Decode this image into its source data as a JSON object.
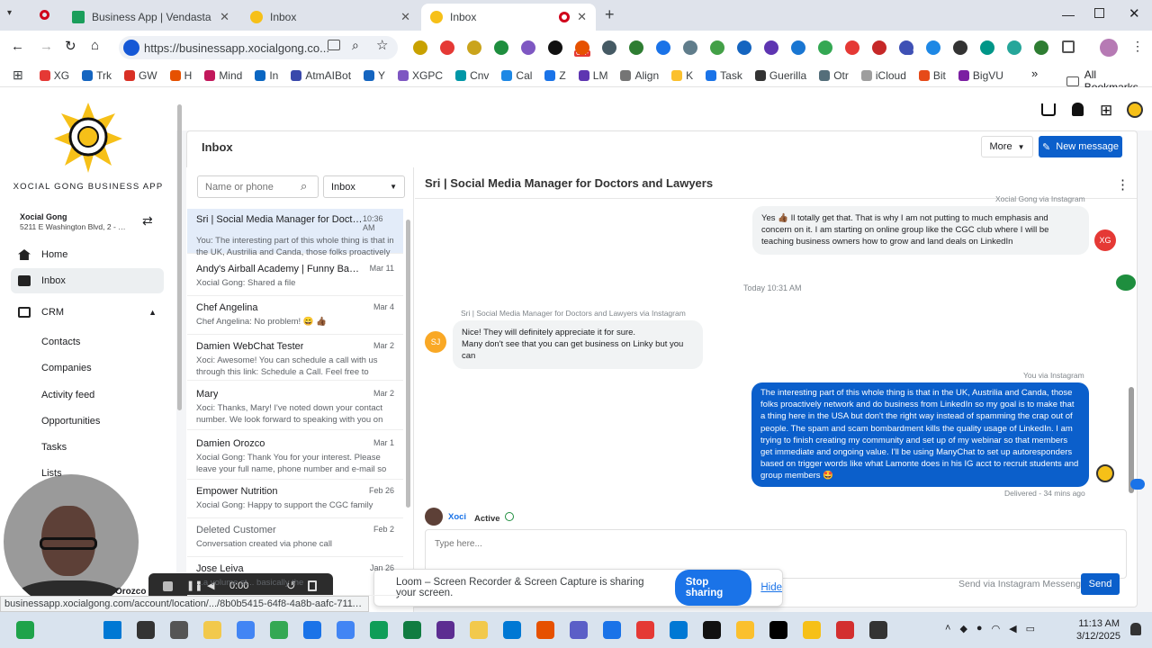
{
  "browser": {
    "tabs": [
      {
        "label": "Business App | Vendasta"
      },
      {
        "label": "Inbox"
      },
      {
        "label": "Inbox"
      }
    ],
    "new_tab": "+",
    "url": "https://businessapp.xocialgong.co...",
    "bookmarks": [
      "XG",
      "Trk",
      "GW",
      "H",
      "Mind",
      "In",
      "AtmAIBot",
      "Y",
      "XGPC",
      "Cnv",
      "Cal",
      "Z",
      "LM",
      "Align",
      "K",
      "Task",
      "Guerilla",
      "Otr",
      "iCloud",
      "Bit",
      "BigVU"
    ],
    "all_bookmarks": "All Bookmarks",
    "ext_badge": "28",
    "ext_off": "OFF"
  },
  "sidebar": {
    "brand": "XOCIAL GONG BUSINESS APP",
    "account_name": "Xocial Gong",
    "account_address": "5211 E Washington Blvd, 2 - 1...",
    "nav": [
      {
        "label": "Home"
      },
      {
        "label": "Inbox"
      },
      {
        "label": "CRM"
      }
    ],
    "crm_items": [
      "Contacts",
      "Companies",
      "Activity feed",
      "Opportunities",
      "Tasks",
      "Lists"
    ],
    "webcam_name": "Orozco"
  },
  "inbox": {
    "title": "Inbox",
    "more": "More",
    "new_message": "New message",
    "search_placeholder": "Name or phone",
    "filter": "Inbox",
    "conversations": [
      {
        "name": "Sri | Social Media Manager for Doctors and Lawyers",
        "date": "10:36 AM",
        "preview": "You: The interesting part of this whole thing is that in the UK, Austrilia and Canda, those folks proactively ..."
      },
      {
        "name": "Andy's Airball Academy | Funny Basketball",
        "date": "Mar 11",
        "preview": "Xocial Gong: Shared a file"
      },
      {
        "name": "Chef Angelina",
        "date": "Mar 4",
        "preview": "Chef Angelina: No problem! 😄 👍🏾"
      },
      {
        "name": "Damien WebChat Tester",
        "date": "Mar 2",
        "preview": "Xoci: Awesome! You can schedule a call with us through this link: Schedule a Call. Feel free to choose a ti..."
      },
      {
        "name": "Mary",
        "date": "Mar 2",
        "preview": "Xoci: Thanks, Mary! I've noted down your contact number. We look forward to speaking with you on the..."
      },
      {
        "name": "Damien Orozco",
        "date": "Mar 1",
        "preview": "Xocial Gong: Thank You for your interest. Please leave your full name, phone number and e-mail so that..."
      },
      {
        "name": "Empower Nutrition",
        "date": "Feb 26",
        "preview": "Xocial Gong: Happy to support the CGC family"
      },
      {
        "name": "Deleted Customer",
        "date": "Feb 2",
        "preview": "Conversation created via phone call"
      },
      {
        "name": "Jose Leiva",
        "date": "Jan 26",
        "preview": "...a volume st... basically the"
      }
    ]
  },
  "chat": {
    "title": "Sri | Social Media Manager for Doctors and Lawyers",
    "top_meta": "Xocial Gong via Instagram",
    "msg1": "Yes 👍🏾 Il totally get that. That is why I am not putting to much emphasis and concern on it. I am starting on online group like the CGC club where I will be teaching business owners how to grow and land deals on LinkedIn",
    "avatar_xg": "XG",
    "divider": "Today 10:31 AM",
    "in_meta_name": "Sri | Social Media Manager for Doctors and Lawyers",
    "in_meta_via": "via Instagram",
    "avatar_sj": "SJ",
    "msg2_line1": "Nice! They will definitely appreciate it for sure.",
    "msg2_line2": "Many don't see that you can get business on Linky but you can",
    "out_meta_you": "You",
    "out_meta_via": "via Instagram",
    "msg3": "The interesting part of this whole thing is that in the UK, Austrilia and Canda, those folks proactively network and do business from LinkedIn so my goal is to make that a thing here in the USA but don't the right way instead of spamming the crap out of people. The spam and scam bombardment kills the quality usage of LinkedIn. I am trying to finish creating my community and set up of my webinar so that members get immediate and ongoing value. I'll be using ManyChat to set up autoresponders based on trigger words like what Lamonte does in his IG acct to recruit students and group members 🤩",
    "delivered": "Delivered - 34 mins ago",
    "assignee": "Xoci",
    "active": "Active",
    "type_placeholder": "Type here...",
    "send_via": "Send via Instagram Messenger",
    "send": "Send"
  },
  "loom": {
    "text": "Loom – Screen Recorder & Screen Capture is sharing your screen.",
    "stop": "Stop sharing",
    "hide": "Hide",
    "timer": "0:00"
  },
  "statusbar": "businessapp.xocialgong.com/account/location/.../8b0b5415-64f8-4a8b-aafc-7111f023800a",
  "taskbar": {
    "time": "11:13 AM",
    "date": "3/12/2025"
  },
  "colors": {
    "brand_blue": "#0b5fcb",
    "accent_gold": "#f6c018"
  }
}
